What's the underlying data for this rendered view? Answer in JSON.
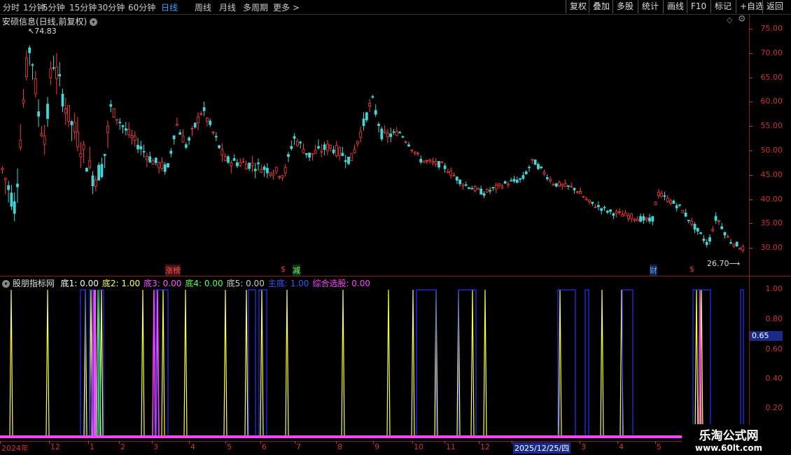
{
  "toolbar": {
    "periods": [
      "分时",
      "1分钟",
      "5分钟",
      "15分钟",
      "30分钟",
      "60分钟",
      "日线",
      "周线",
      "月线",
      "多周期",
      "更多 >"
    ],
    "active_index": 6,
    "right_buttons": [
      "复权",
      "叠加",
      "多股",
      "统计",
      "画线",
      "F10",
      "标记",
      "+自选",
      "返回"
    ]
  },
  "main_chart": {
    "title": "安硕信息(日线,前复权)",
    "price_axis": [
      "75.00",
      "70.00",
      "65.00",
      "60.00",
      "55.00",
      "50.00",
      "45.00",
      "40.00",
      "35.00",
      "30.00"
    ],
    "high_label": "74.83",
    "low_label": "26.70",
    "event_markers": [
      {
        "text": "涨榜",
        "color": "#ff5555",
        "bg": "#441111"
      },
      {
        "text": "$",
        "color": "#ff3333",
        "bg": ""
      },
      {
        "text": "减",
        "color": "#66ff66",
        "bg": "#113311"
      },
      {
        "text": "财",
        "color": "#66aaff",
        "bg": "#112244"
      },
      {
        "text": "$",
        "color": "#ff3333",
        "bg": ""
      }
    ]
  },
  "indicator": {
    "name": "股朋指标网",
    "items": [
      {
        "label": "底1:",
        "value": "0.00",
        "color": "#ffffff"
      },
      {
        "label": "底2:",
        "value": "1.00",
        "color": "#ffff55"
      },
      {
        "label": "底3:",
        "value": "0.00",
        "color": "#ff55ff"
      },
      {
        "label": "底4:",
        "value": "0.00",
        "color": "#55ff55"
      },
      {
        "label": "底5:",
        "value": "0.00",
        "color": "#cccccc"
      },
      {
        "label": "主底:",
        "value": "1.00",
        "color": "#3355ff"
      },
      {
        "label": "综合选股:",
        "value": "0.00",
        "color": "#ff44ff"
      }
    ],
    "axis": [
      "1.00",
      "0.80",
      "0.60",
      "0.40",
      "0.20"
    ],
    "cursor_value": "0.65"
  },
  "date_axis": [
    "2024年",
    "12",
    "1",
    "2",
    "3",
    "4",
    "5",
    "6",
    "7",
    "8",
    "9",
    "10",
    "11",
    "12",
    "2025/12/25/四",
    "3",
    "4",
    "5"
  ],
  "watermark": {
    "line1": "乐淘公式网",
    "line2": "www.60lt.com"
  }
}
